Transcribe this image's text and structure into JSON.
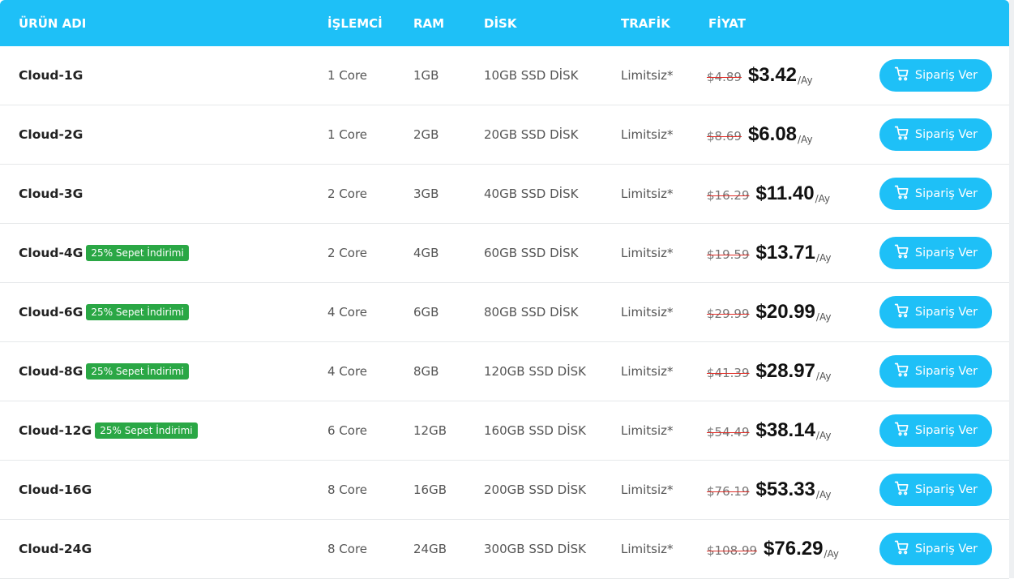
{
  "header": {
    "name": "ÜRÜN ADI",
    "cpu": "İŞLEMCİ",
    "ram": "RAM",
    "disk": "DİSK",
    "traffic": "TRAFİK",
    "price": "FİYAT"
  },
  "button_label": "Sipariş Ver",
  "per_label": "/Ay",
  "rows": [
    {
      "name": "Cloud-1G",
      "badge": "",
      "cpu": "1 Core",
      "ram": "1GB",
      "disk": "10GB SSD DİSK",
      "traffic": "Limitsiz*",
      "old_price": "$4.89",
      "price": "$3.42"
    },
    {
      "name": "Cloud-2G",
      "badge": "",
      "cpu": "1 Core",
      "ram": "2GB",
      "disk": "20GB SSD DİSK",
      "traffic": "Limitsiz*",
      "old_price": "$8.69",
      "price": "$6.08"
    },
    {
      "name": "Cloud-3G",
      "badge": "",
      "cpu": "2 Core",
      "ram": "3GB",
      "disk": "40GB SSD DİSK",
      "traffic": "Limitsiz*",
      "old_price": "$16.29",
      "price": "$11.40"
    },
    {
      "name": "Cloud-4G",
      "badge": "25% Sepet İndirimi",
      "cpu": "2 Core",
      "ram": "4GB",
      "disk": "60GB SSD DİSK",
      "traffic": "Limitsiz*",
      "old_price": "$19.59",
      "price": "$13.71"
    },
    {
      "name": "Cloud-6G",
      "badge": "25% Sepet İndirimi",
      "cpu": "4 Core",
      "ram": "6GB",
      "disk": "80GB SSD DİSK",
      "traffic": "Limitsiz*",
      "old_price": "$29.99",
      "price": "$20.99"
    },
    {
      "name": "Cloud-8G",
      "badge": "25% Sepet İndirimi",
      "cpu": "4 Core",
      "ram": "8GB",
      "disk": "120GB SSD DİSK",
      "traffic": "Limitsiz*",
      "old_price": "$41.39",
      "price": "$28.97"
    },
    {
      "name": "Cloud-12G",
      "badge": "25% Sepet İndirimi",
      "cpu": "6 Core",
      "ram": "12GB",
      "disk": "160GB SSD DİSK",
      "traffic": "Limitsiz*",
      "old_price": "$54.49",
      "price": "$38.14"
    },
    {
      "name": "Cloud-16G",
      "badge": "",
      "cpu": "8 Core",
      "ram": "16GB",
      "disk": "200GB SSD DİSK",
      "traffic": "Limitsiz*",
      "old_price": "$76.19",
      "price": "$53.33"
    },
    {
      "name": "Cloud-24G",
      "badge": "",
      "cpu": "8 Core",
      "ram": "24GB",
      "disk": "300GB SSD DİSK",
      "traffic": "Limitsiz*",
      "old_price": "$108.99",
      "price": "$76.29"
    }
  ],
  "colors": {
    "accent": "#1ec0f7",
    "badge": "#2aa745",
    "strike": "#e0302a"
  },
  "icons": {
    "button": "shopping-cart-icon"
  }
}
